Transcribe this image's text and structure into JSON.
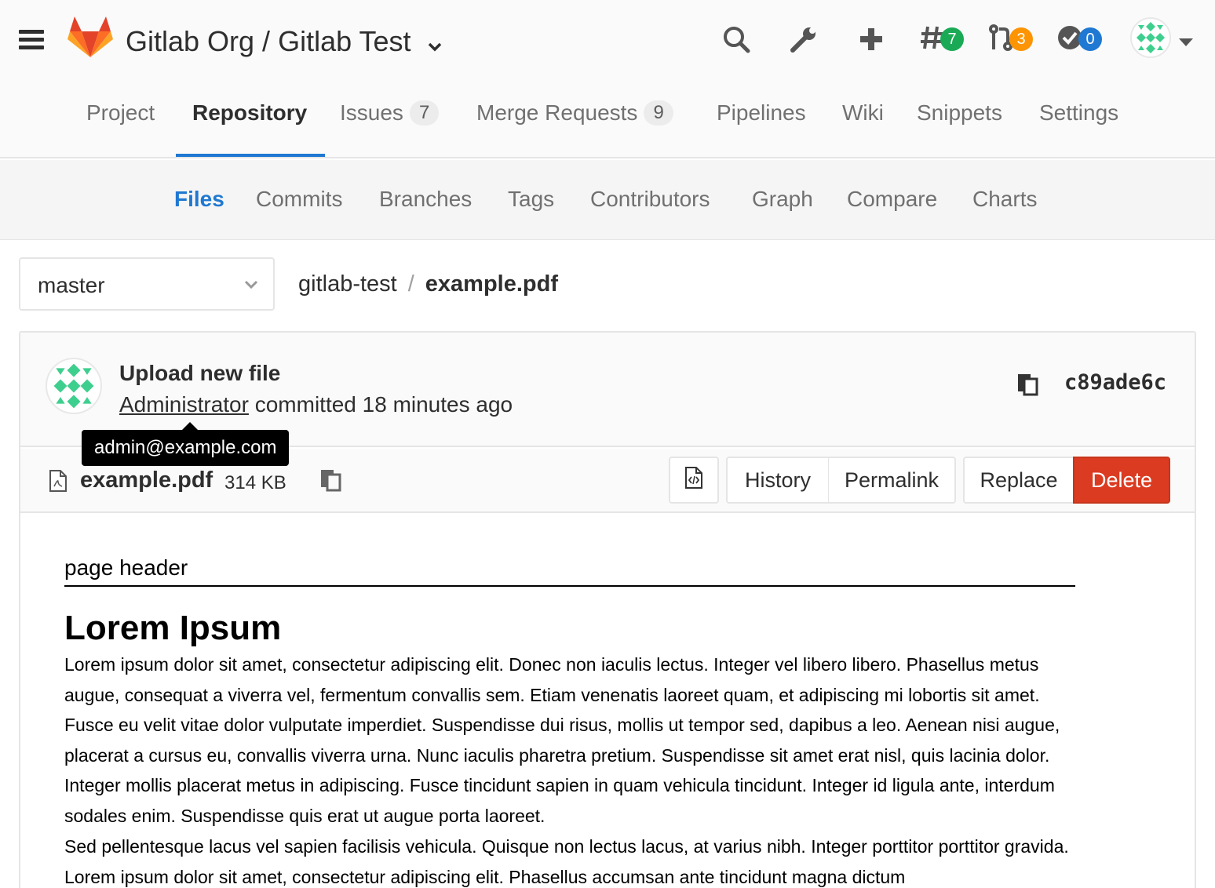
{
  "header": {
    "title": "Gitlab Org / Gitlab Test",
    "todos_count": "7",
    "merge_requests_count": "3",
    "pipelines_count": "0"
  },
  "nav": {
    "project": "Project",
    "repository": "Repository",
    "issues": "Issues",
    "issues_count": "7",
    "merge_requests": "Merge Requests",
    "merge_requests_count": "9",
    "pipelines": "Pipelines",
    "wiki": "Wiki",
    "snippets": "Snippets",
    "settings": "Settings"
  },
  "subnav": {
    "files": "Files",
    "commits": "Commits",
    "branches": "Branches",
    "tags": "Tags",
    "contributors": "Contributors",
    "graph": "Graph",
    "compare": "Compare",
    "charts": "Charts"
  },
  "branch": "master",
  "breadcrumb": {
    "repo": "gitlab-test",
    "separator": "/",
    "file": "example.pdf"
  },
  "commit": {
    "title": "Upload new file",
    "author": "Administrator",
    "action": "committed 18 minutes ago",
    "sha": "c89ade6c",
    "tooltip": "admin@example.com"
  },
  "file": {
    "name": "example.pdf",
    "size": "314 KB",
    "buttons": {
      "history": "History",
      "permalink": "Permalink",
      "replace": "Replace",
      "delete": "Delete"
    }
  },
  "pdf": {
    "page_header": "page header",
    "heading": "Lorem Ipsum",
    "paragraph1": "Lorem ipsum dolor sit amet, consectetur adipiscing elit. Donec non iaculis lectus. Integer vel libero libero. Phasellus metus augue, consequat a viverra vel, fermentum convallis sem. Etiam venenatis laoreet quam, et adipiscing mi lobortis sit amet. Fusce eu velit vitae dolor vulputate imperdiet. Suspendisse dui risus, mollis ut tempor sed, dapibus a leo. Aenean nisi augue, placerat a cursus eu, convallis viverra urna. Nunc iaculis pharetra pretium. Suspendisse sit amet erat nisl, quis lacinia dolor. Integer mollis placerat metus in adipiscing. Fusce tincidunt sapien in quam vehicula tincidunt. Integer id ligula ante, interdum sodales enim. Suspendisse quis erat ut augue porta laoreet.",
    "paragraph2": "Sed pellentesque lacus vel sapien facilisis vehicula. Quisque non lectus lacus, at varius nibh. Integer porttitor porttitor gravida. Lorem ipsum dolor sit amet, consectetur adipiscing elit. Phasellus accumsan ante tincidunt magna dictum"
  },
  "colors": {
    "accent_blue": "#1f78d1",
    "success_green": "#1aaa55",
    "warning_orange": "#fc9403",
    "danger_red": "#db3b21",
    "logo_orange": "#fc6d26"
  },
  "icons": {
    "menu": "hamburger-icon",
    "logo": "gitlab-tanuki-logo",
    "search": "search-icon",
    "admin": "wrench-icon",
    "new": "plus-icon",
    "todos": "hash-icon",
    "merge_requests": "merge-request-icon",
    "pipelines": "check-circle-icon",
    "copy": "clipboard-icon",
    "file": "pdf-file-icon",
    "raw": "file-code-icon"
  }
}
